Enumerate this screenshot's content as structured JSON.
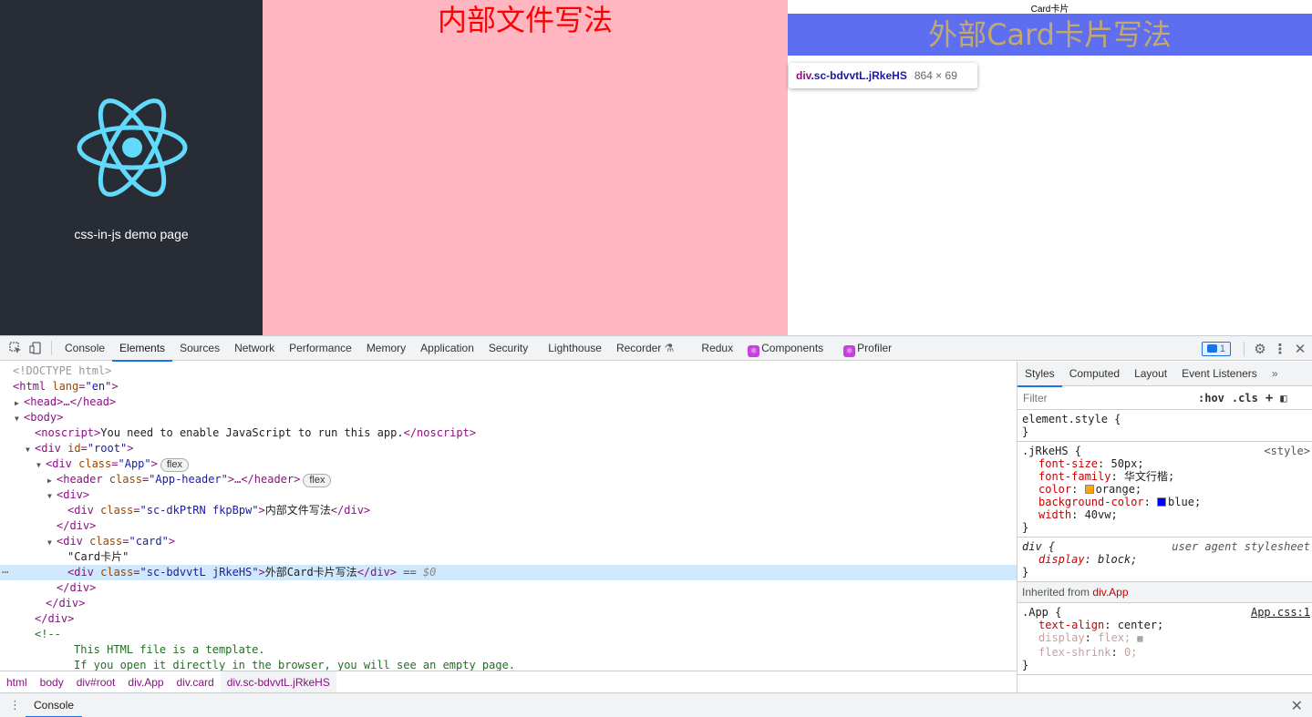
{
  "viewport": {
    "header_text": "css-in-js demo page",
    "inner_title": "内部文件写法",
    "card_label": "Card卡片",
    "card_title": "外部Card卡片写法",
    "tooltip": {
      "tag": "div",
      "classes": ".sc-bdvvtL.jRkeHS",
      "size": "864 × 69"
    }
  },
  "devtools": {
    "tabs": [
      "Console",
      "Elements",
      "Sources",
      "Network",
      "Performance",
      "Memory",
      "Application",
      "Security",
      "Lighthouse",
      "Recorder",
      "Redux",
      "Components",
      "Profiler"
    ],
    "active_tab": "Elements",
    "message_count": "1",
    "dom": {
      "l0": "<!DOCTYPE html>",
      "l1_tag": "<html",
      "l1_an": " lang",
      "l1_av": "\"en\"",
      "l1_end": ">",
      "l2": "<head>…</head>",
      "l3": "<body>",
      "l4_open": "<noscript>",
      "l4_text": "You need to enable JavaScript to run this app.",
      "l4_close": "</noscript>",
      "l5_tag": "<div",
      "l5_an": " id",
      "l5_av": "\"root\"",
      "l5_end": ">",
      "l6_tag": "<div",
      "l6_an": " class",
      "l6_av": "\"App\"",
      "l6_end": ">",
      "l6_badge": "flex",
      "l7_tag": "<header",
      "l7_an": " class",
      "l7_av": "\"App-header\"",
      "l7_end": ">…</header>",
      "l7_badge": "flex",
      "l8": "<div>",
      "l9_tag": "<div",
      "l9_an": " class",
      "l9_av": "\"sc-dkPtRN fkpBpw\"",
      "l9_end": ">",
      "l9_text": "内部文件写法",
      "l9_close": "</div>",
      "l10": "</div>",
      "l11_tag": "<div",
      "l11_an": " class",
      "l11_av": "\"card\"",
      "l11_end": ">",
      "l12": "\"Card卡片\"",
      "l13_tag": "<div",
      "l13_an": " class",
      "l13_av": "\"sc-bdvvtL jRkeHS\"",
      "l13_end": ">",
      "l13_text": "外部Card卡片写法",
      "l13_close": "</div>",
      "l13_eq": " == ",
      "l13_ref": "$0",
      "l14": "</div>",
      "l15": "</div>",
      "l16": "</div>",
      "l17": "<!--",
      "l18": "This HTML file is a template.",
      "l19": "If you open it directly in the browser, you will see an empty page."
    },
    "breadcrumbs": [
      "html",
      "body",
      "div#root",
      "div.App",
      "div.card",
      "div.sc-bdvvtL.jRkeHS"
    ],
    "drawer_tab": "Console",
    "styles": {
      "tabs": [
        "Styles",
        "Computed",
        "Layout",
        "Event Listeners"
      ],
      "filter_placeholder": "Filter",
      "hov": ":hov",
      "cls": ".cls",
      "element_style": "element.style {",
      "close_brace": "}",
      "rule1_selector": ".jRkeHS {",
      "rule1_source": "<style>",
      "rule1": [
        {
          "name": "font-size",
          "value": "50px;"
        },
        {
          "name": "font-family",
          "value": "华文行楷;"
        },
        {
          "name": "color",
          "value": "orange;",
          "swatch": "#ffa500"
        },
        {
          "name": "background-color",
          "value": "blue;",
          "swatch": "#0000ff"
        },
        {
          "name": "width",
          "value": "40vw;"
        }
      ],
      "rule2_selector": "div {",
      "rule2_source": "user agent stylesheet",
      "rule2_prop": {
        "name": "display",
        "value": "block;"
      },
      "inherited_label": "Inherited from",
      "inherited_from": "div.App",
      "rule3_selector": ".App {",
      "rule3_source": "App.css:1",
      "rule3": [
        {
          "name": "text-align",
          "value": "center;"
        },
        {
          "name": "display",
          "value": "flex;"
        },
        {
          "name": "flex-shrink",
          "value": "0;"
        }
      ]
    }
  }
}
